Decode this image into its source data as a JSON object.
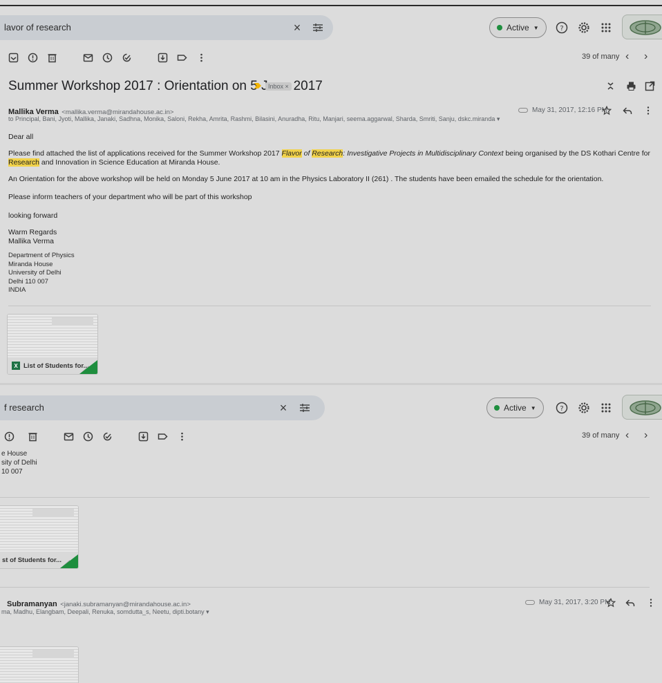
{
  "top": {
    "search_text_1": "lavor of research",
    "search_text_2": "f research",
    "active_label": "Active",
    "count_label": "39 of many"
  },
  "subject": {
    "title": "Summer Workshop 2017 : Orientation on 5 June 2017",
    "label_chip": "Inbox ×"
  },
  "message1": {
    "sender_name": "Mallika Verma",
    "sender_email": "<mallika.verma@mirandahouse.ac.in>",
    "recipients": "to Principal, Bani, Jyoti, Mallika, Janaki, Sadhna, Monika, Saloni, Rekha, Amrita, Rashmi, Bilasini, Anuradha, Ritu, Manjari, seema.aggarwal, Sharda, Smriti, Sanju, dskc.miranda ▾",
    "date": "May 31, 2017, 12:16 PM",
    "greeting": "Dear all",
    "p1_a": "Please find attached the list of applications received for the Summer Workshop 2017 ",
    "p1_flavor": "Flavor",
    "p1_of": " of ",
    "p1_research": "Research",
    "p1_b": ": Investigative Projects in Multidisciplinary Context",
    "p1_c": " being organised by the DS Kothari Centre for ",
    "p1_research2": "Research",
    "p1_d": " and Innovation in Science Education at Miranda House.",
    "p2": "An Orientation for the above workshop will be held on Monday 5 June 2017 at 10 am in the Physics Laboratory II (261) . The students have been emailed the schedule for the orientation.",
    "p3": "Please inform teachers of your department who will be part of this workshop",
    "p4": "looking forward",
    "p5a": "Warm Regards",
    "p5b": "Mallika Verma",
    "sig": [
      "Department of Physics",
      "Miranda House",
      "University of Delhi",
      "Delhi 110 007",
      "INDIA"
    ],
    "attachment_name": "List of Students for..."
  },
  "pane2": {
    "sig": [
      "e House",
      "sity of Delhi",
      "10 007"
    ],
    "attachment_name": "st of Students for..."
  },
  "message2": {
    "sender_name": "Subramanyan",
    "sender_email": "<janaki.subramanyan@mirandahouse.ac.in>",
    "recipients": "ma, Madhu, Elangbam, Deepali, Renuka, somdutta_s, Neetu, dipti.botany ▾",
    "date": "May 31, 2017, 3:20 PM"
  },
  "colors": {
    "background": "#dcdcdc",
    "highlight": "#f1d24a",
    "active_dot": "#1e8e3e",
    "importance": "#f2b400",
    "excel_green": "#1e7145"
  }
}
